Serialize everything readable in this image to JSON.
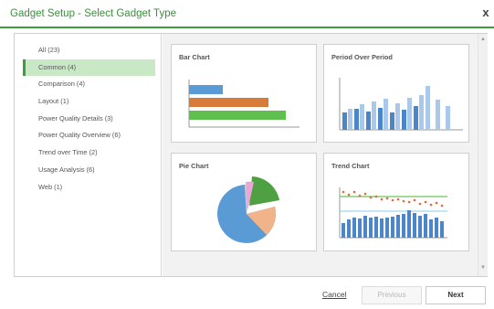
{
  "dialog": {
    "title": "Gadget Setup - Select Gadget Type",
    "close_label": "x",
    "accent_color": "#3b9d3b"
  },
  "categories": [
    {
      "label": "All (23)",
      "selected": false
    },
    {
      "label": "Common (4)",
      "selected": true
    },
    {
      "label": "Comparison (4)",
      "selected": false
    },
    {
      "label": "Layout (1)",
      "selected": false
    },
    {
      "label": "Power Quality Details (3)",
      "selected": false
    },
    {
      "label": "Power Quality Overview (6)",
      "selected": false
    },
    {
      "label": "Trend over Time (2)",
      "selected": false
    },
    {
      "label": "Usage Analysis (6)",
      "selected": false
    },
    {
      "label": "Web (1)",
      "selected": false
    }
  ],
  "gadgets": [
    {
      "title": "Bar Chart",
      "icon": "bar-chart-preview"
    },
    {
      "title": "Period Over Period",
      "icon": "period-over-period-preview"
    },
    {
      "title": "Pie Chart",
      "icon": "pie-chart-preview"
    },
    {
      "title": "Trend Chart",
      "icon": "trend-chart-preview"
    }
  ],
  "footer": {
    "cancel_label": "Cancel",
    "previous_label": "Previous",
    "next_label": "Next"
  }
}
